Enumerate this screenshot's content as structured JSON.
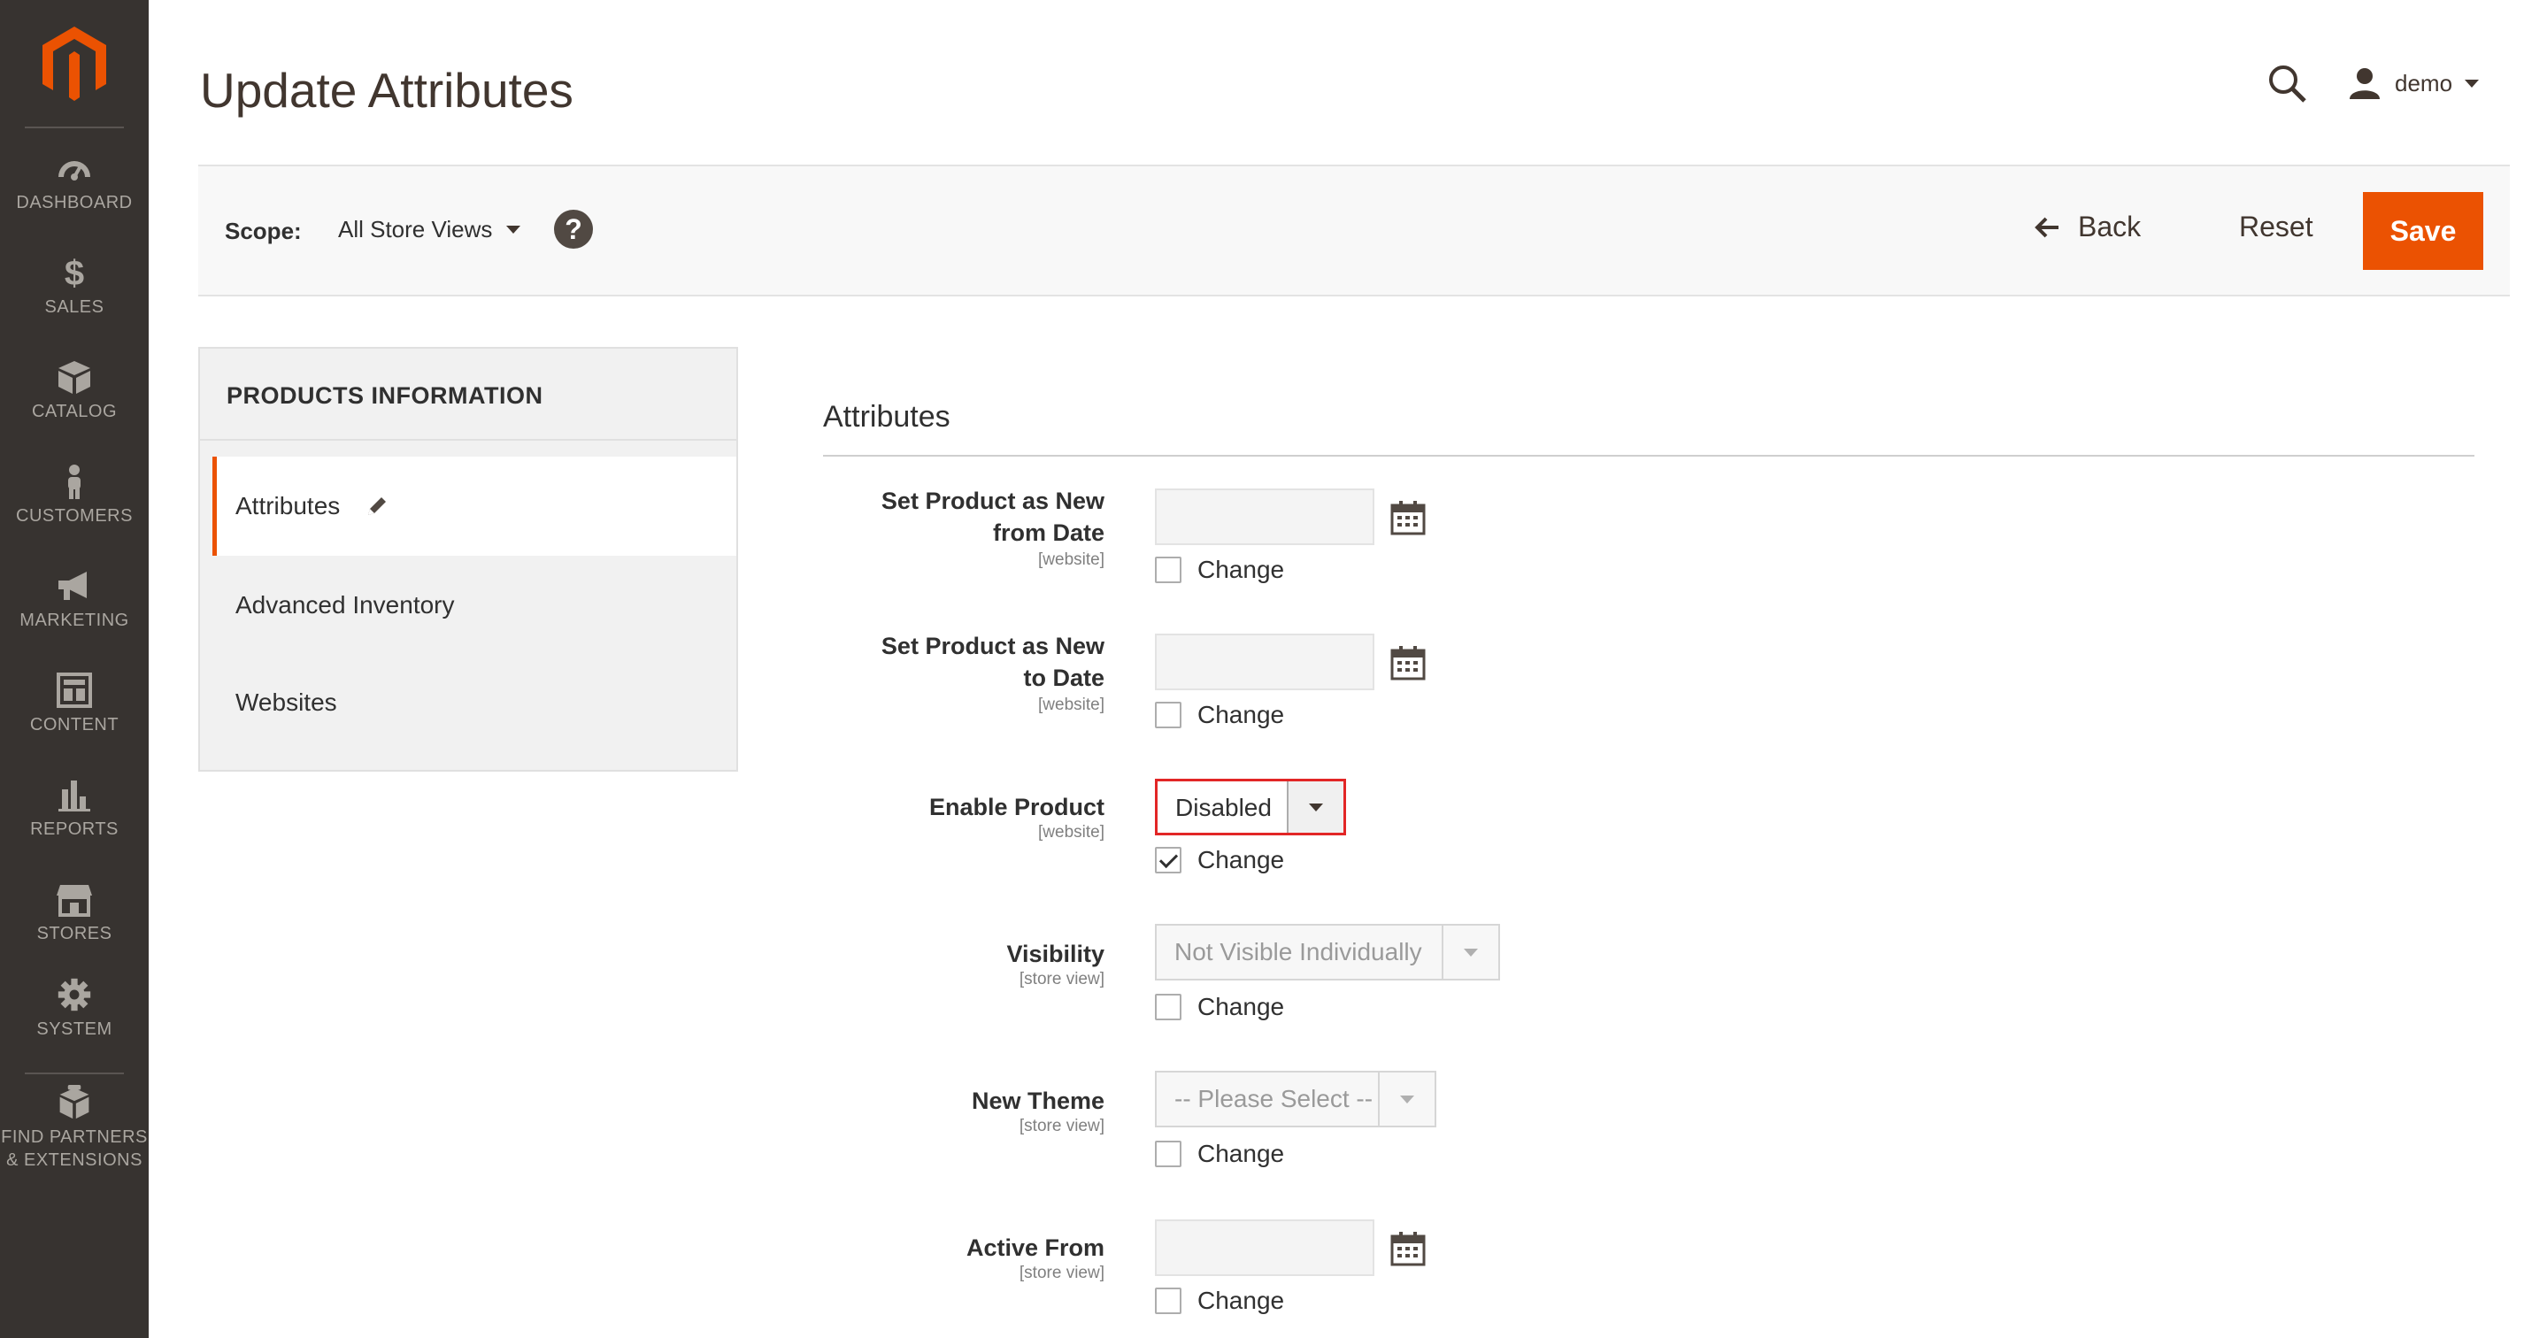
{
  "sidebar": {
    "logo": "magento-logo",
    "items": [
      {
        "label": "DASHBOARD",
        "icon": "dashboard-icon"
      },
      {
        "label": "SALES",
        "icon": "dollar-icon"
      },
      {
        "label": "CATALOG",
        "icon": "box-icon"
      },
      {
        "label": "CUSTOMERS",
        "icon": "person-icon"
      },
      {
        "label": "MARKETING",
        "icon": "megaphone-icon"
      },
      {
        "label": "CONTENT",
        "icon": "layout-icon"
      },
      {
        "label": "REPORTS",
        "icon": "bar-chart-icon"
      },
      {
        "label": "STORES",
        "icon": "storefront-icon"
      },
      {
        "label": "SYSTEM",
        "icon": "gear-icon"
      },
      {
        "label": "FIND PARTNERS & EXTENSIONS",
        "label_line1": "FIND PARTNERS",
        "label_line2": "& EXTENSIONS",
        "icon": "package-icon"
      }
    ]
  },
  "header": {
    "title": "Update Attributes",
    "user": "demo"
  },
  "action_bar": {
    "scope_label": "Scope:",
    "scope_value": "All Store Views",
    "back_label": "Back",
    "reset_label": "Reset",
    "save_label": "Save"
  },
  "tabs": {
    "title": "PRODUCTS INFORMATION",
    "items": [
      {
        "label": "Attributes",
        "active": true
      },
      {
        "label": "Advanced Inventory",
        "active": false
      },
      {
        "label": "Websites",
        "active": false
      }
    ]
  },
  "form": {
    "section_title": "Attributes",
    "change_label": "Change",
    "fields": [
      {
        "label_line1": "Set Product as New",
        "label_line2": "from Date",
        "scope": "[website]",
        "type": "date",
        "value": "",
        "change_checked": false
      },
      {
        "label_line1": "Set Product as New",
        "label_line2": "to Date",
        "scope": "[website]",
        "type": "date",
        "value": "",
        "change_checked": false
      },
      {
        "label_line1": "Enable Product",
        "scope": "[website]",
        "type": "select",
        "value": "Disabled",
        "change_checked": true
      },
      {
        "label_line1": "Visibility",
        "scope": "[store view]",
        "type": "select",
        "value": "Not Visible Individually",
        "change_checked": false
      },
      {
        "label_line1": "New Theme",
        "scope": "[store view]",
        "type": "select",
        "value": "-- Please Select --",
        "change_checked": false
      },
      {
        "label_line1": "Active From",
        "scope": "[store view]",
        "type": "date",
        "value": "",
        "change_checked": false
      }
    ]
  },
  "colors": {
    "sidebar_bg": "#373330",
    "accent": "#eb5202",
    "focus_border": "#e22626"
  }
}
